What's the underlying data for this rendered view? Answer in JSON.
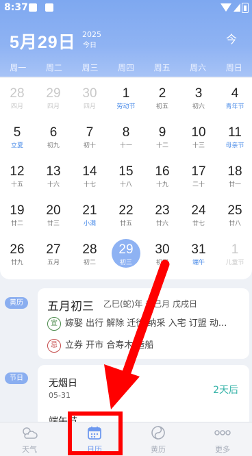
{
  "status": {
    "time": "8:37"
  },
  "header": {
    "date": "5月29日",
    "year": "2025",
    "today_label": "今日",
    "today_button": "今"
  },
  "weekdays": [
    "周一",
    "周二",
    "周三",
    "周四",
    "周五",
    "周六",
    "周日"
  ],
  "calendar": [
    {
      "d": "28",
      "l": "四月",
      "dim": true
    },
    {
      "d": "29",
      "l": "四月",
      "dim": true
    },
    {
      "d": "30",
      "l": "四月",
      "dim": true
    },
    {
      "d": "1",
      "l": "劳动节",
      "hol": true
    },
    {
      "d": "2",
      "l": "初五"
    },
    {
      "d": "3",
      "l": "初六"
    },
    {
      "d": "4",
      "l": "青年节",
      "hol": true
    },
    {
      "d": "5",
      "l": "立夏",
      "hol": true
    },
    {
      "d": "6",
      "l": "初九"
    },
    {
      "d": "7",
      "l": "初十"
    },
    {
      "d": "8",
      "l": "十一"
    },
    {
      "d": "9",
      "l": "十二"
    },
    {
      "d": "10",
      "l": "十三"
    },
    {
      "d": "11",
      "l": "母亲节",
      "hol": true
    },
    {
      "d": "12",
      "l": "十五"
    },
    {
      "d": "13",
      "l": "十六"
    },
    {
      "d": "14",
      "l": "十七"
    },
    {
      "d": "15",
      "l": "十八"
    },
    {
      "d": "16",
      "l": "十九"
    },
    {
      "d": "17",
      "l": "二十"
    },
    {
      "d": "18",
      "l": "廿一"
    },
    {
      "d": "19",
      "l": "廿二"
    },
    {
      "d": "20",
      "l": "廿三"
    },
    {
      "d": "21",
      "l": "小满",
      "hol": true
    },
    {
      "d": "22",
      "l": "廿五"
    },
    {
      "d": "23",
      "l": "廿六"
    },
    {
      "d": "24",
      "l": "廿七"
    },
    {
      "d": "25",
      "l": "廿八"
    },
    {
      "d": "26",
      "l": "廿九"
    },
    {
      "d": "27",
      "l": "五月"
    },
    {
      "d": "28",
      "l": "初二"
    },
    {
      "d": "29",
      "l": "初三",
      "sel": true
    },
    {
      "d": "30",
      "l": "初四"
    },
    {
      "d": "31",
      "l": "端午",
      "hol": true
    },
    {
      "d": "1",
      "l": "儿童节",
      "dim": true
    }
  ],
  "almanac": {
    "tag": "黄历",
    "title": "五月初三",
    "sub": "乙巳(蛇)年 辛巳月 戊戌日",
    "yi_label": "宜",
    "yi": "嫁娶 出行 解除 迁徙 纳采 入宅 订盟 动...",
    "ji_label": "忌",
    "ji": "立券 开市 合寿木 造船"
  },
  "festival": {
    "tag": "节日",
    "name": "无烟日",
    "date": "05-31",
    "countdown": "2天后",
    "next": "端午节"
  },
  "tabs": [
    {
      "label": "天气",
      "icon": "weather-icon"
    },
    {
      "label": "日历",
      "icon": "calendar-icon",
      "active": true
    },
    {
      "label": "黄历",
      "icon": "almanac-icon"
    },
    {
      "label": "更多",
      "icon": "more-icon"
    }
  ],
  "colors": {
    "accent": "#8eb2f3",
    "highlight": "#ff0000",
    "countdown": "#36b3a8"
  }
}
